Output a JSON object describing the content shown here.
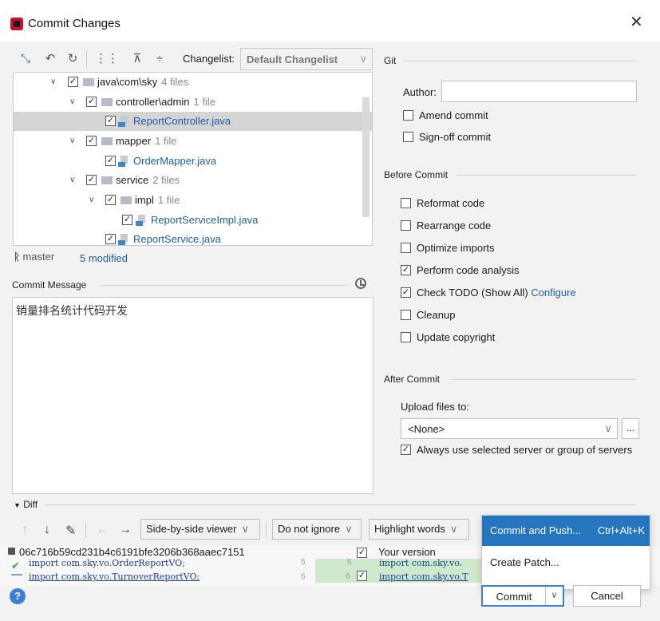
{
  "window": {
    "title": "Commit Changes"
  },
  "toolbar": {
    "changelist_label": "Changelist:",
    "changelist_value": "Default Changelist"
  },
  "tree": {
    "rows": [
      {
        "label": "java\\com\\sky",
        "count": "4 files"
      },
      {
        "label": "controller\\admin",
        "count": "1 file"
      },
      {
        "label": "ReportController.java"
      },
      {
        "label": "mapper",
        "count": "1 file"
      },
      {
        "label": "OrderMapper.java"
      },
      {
        "label": "service",
        "count": "2 files"
      },
      {
        "label": "impl",
        "count": "1 file"
      },
      {
        "label": "ReportServiceImpl.java"
      },
      {
        "label": "ReportService.java"
      }
    ]
  },
  "status": {
    "branch": "master",
    "modified": "5 modified"
  },
  "commit_message": {
    "header": "Commit Message",
    "text": "销量排名统计代码开发"
  },
  "git": {
    "header": "Git",
    "author_label": "Author:",
    "author_value": "",
    "amend": "Amend commit",
    "signoff": "Sign-off commit"
  },
  "before_commit": {
    "header": "Before Commit",
    "options": [
      {
        "label": "Reformat code",
        "checked": false
      },
      {
        "label": "Rearrange code",
        "checked": false
      },
      {
        "label": "Optimize imports",
        "checked": false
      },
      {
        "label": "Perform code analysis",
        "checked": true
      },
      {
        "label": "Check TODO (Show All)",
        "checked": true,
        "link": "Configure"
      },
      {
        "label": "Cleanup",
        "checked": false
      },
      {
        "label": "Update copyright",
        "checked": false
      }
    ]
  },
  "after_commit": {
    "header": "After Commit",
    "upload_label": "Upload files to:",
    "upload_value": "<None>",
    "dots": "...",
    "always_use": "Always use selected server or group of servers"
  },
  "diff": {
    "header": "Diff",
    "viewer": "Side-by-side viewer",
    "ignore": "Do not ignore",
    "highlight": "Highlight words",
    "hash": "06c716b59cd231b4c6191bfe3206b368aaec7151",
    "your_version": "Your version",
    "line_left_1": "import com.sky.vo.OrderReportVO;",
    "line_left_2": "import com.sky.vo.TurnoverReportVO;",
    "line_right_1": "import com.sky.vo.",
    "line_right_2": "import com.sky.vo.T",
    "num_left": "6",
    "num_right": "6",
    "num_top_left": "5",
    "num_top_right": "5"
  },
  "popup": {
    "items": [
      {
        "label": "Commit and Push...",
        "shortcut": "Ctrl+Alt+K"
      },
      {
        "label": "Create Patch..."
      }
    ]
  },
  "buttons": {
    "help": "?",
    "commit": "Commit",
    "cancel": "Cancel"
  },
  "colors": {
    "accent": "#2675bf",
    "link": "#1f5ca8",
    "selection": "#d4d4d4"
  }
}
